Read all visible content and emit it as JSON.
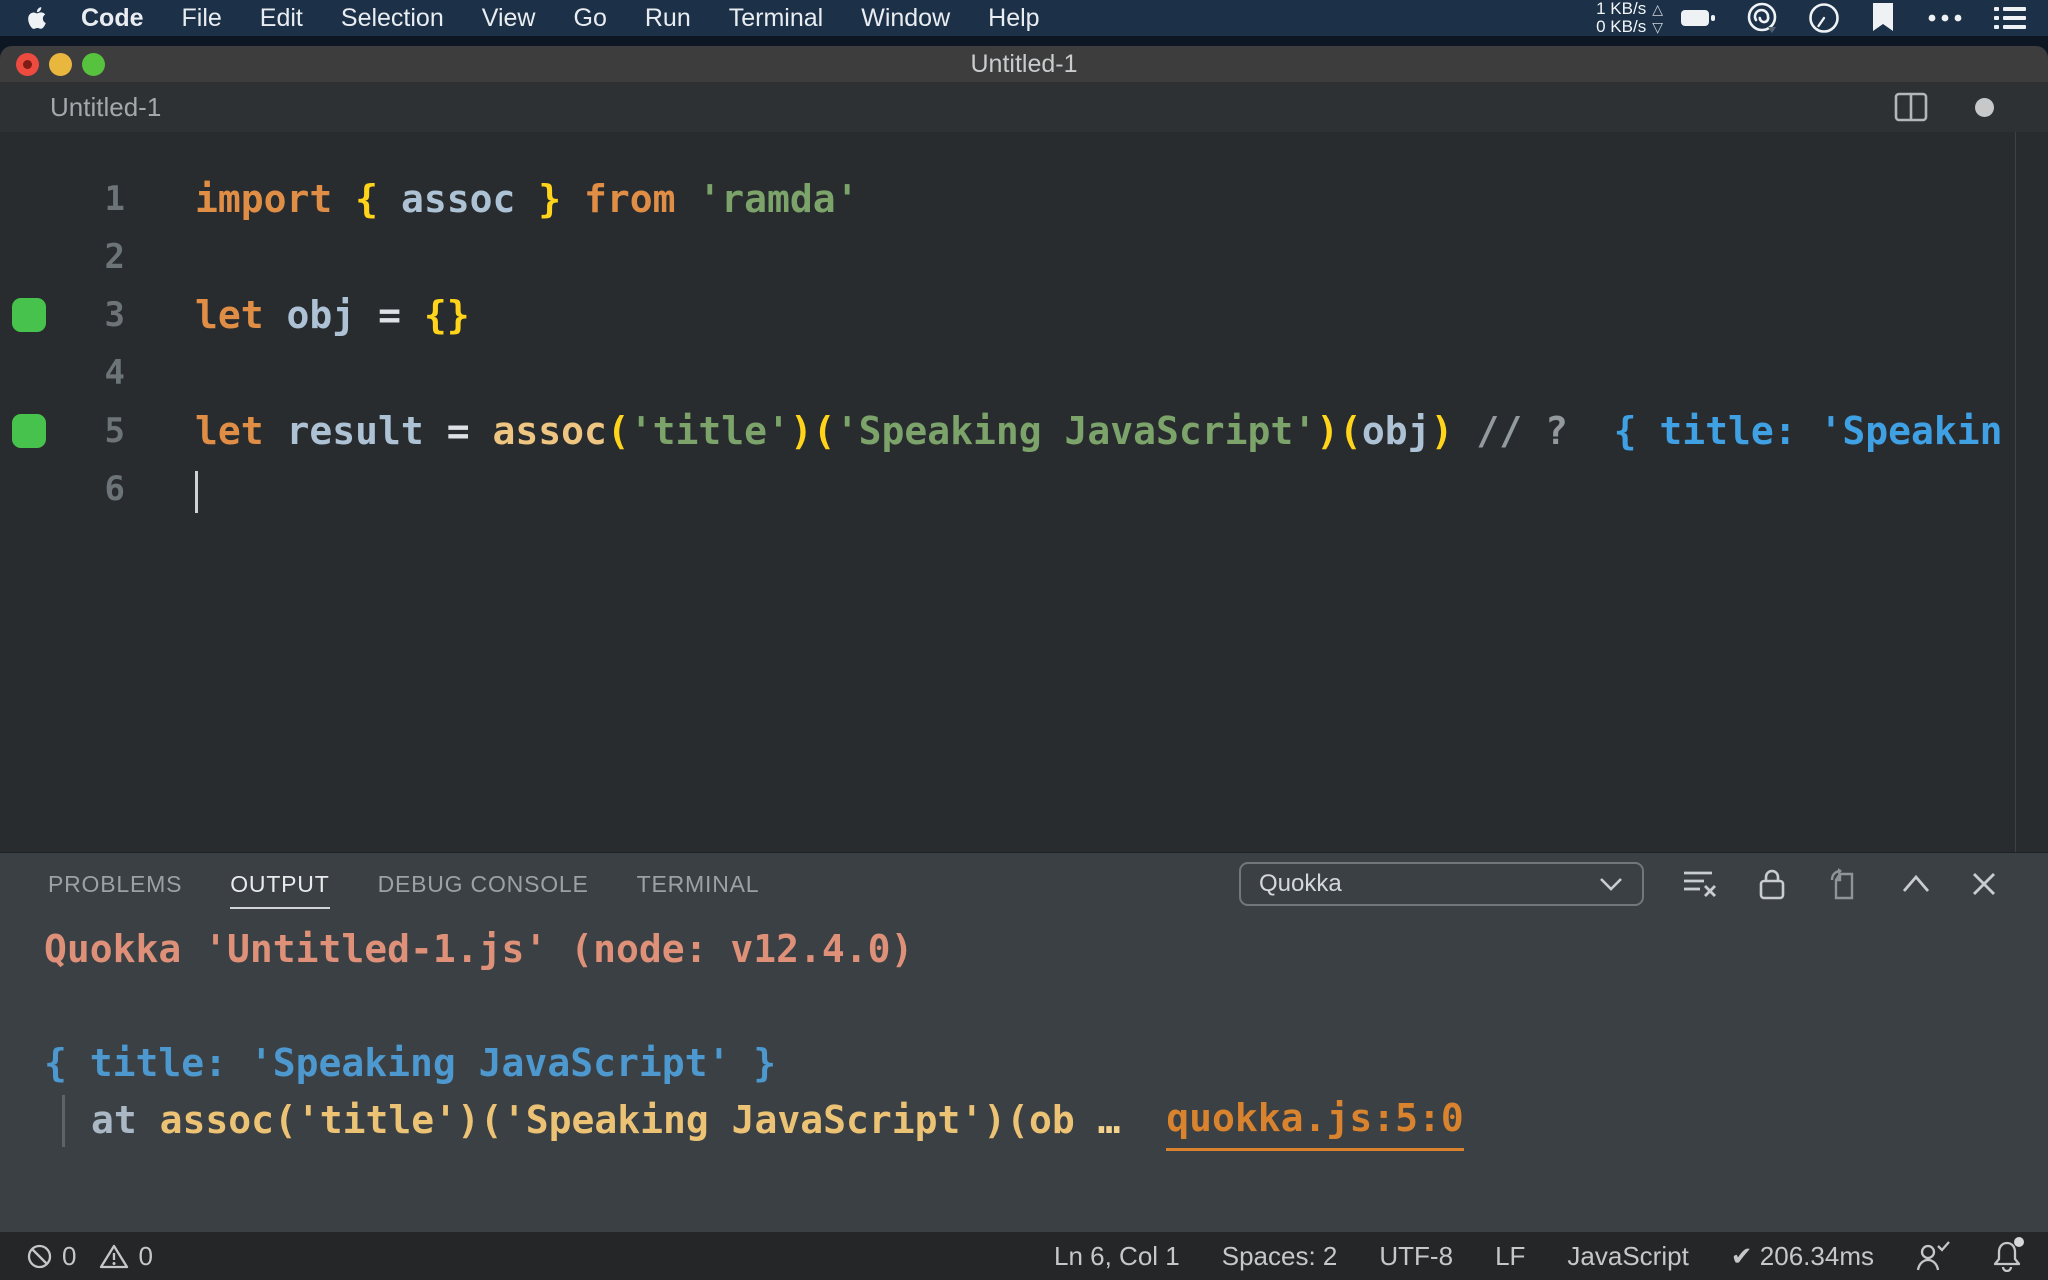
{
  "colors": {
    "menubar_bg": "#1c3048",
    "titlebar_bg": "#3d3d3e",
    "chrome_bg": "#2e3134",
    "editor_bg": "#292c2f",
    "panel_bg": "#3a4044",
    "statusbar_bg": "#252628",
    "keyword": "#e08e45",
    "variable": "#adc2d4",
    "bracket": "#ffd41a",
    "string": "#7ba36a",
    "function": "#eec581",
    "comment": "#939a9e",
    "quokka_inline_value": "#3fa1e3",
    "quokka_marker": "#47c34d",
    "output_info": "#de9078",
    "output_value": "#4d99cf",
    "output_code": "#ecc275",
    "output_link": "#d9832e"
  },
  "menubar": {
    "items": [
      {
        "label": "Code",
        "bold": true
      },
      {
        "label": "File"
      },
      {
        "label": "Edit"
      },
      {
        "label": "Selection"
      },
      {
        "label": "View"
      },
      {
        "label": "Go"
      },
      {
        "label": "Run"
      },
      {
        "label": "Terminal"
      },
      {
        "label": "Window"
      },
      {
        "label": "Help"
      }
    ],
    "net_up": "1 KB/s",
    "net_up_arrow": "△",
    "net_down": "0 KB/s",
    "net_down_arrow": "▽"
  },
  "window": {
    "title": "Untitled-1"
  },
  "editor": {
    "tab_label": "Untitled-1",
    "lines": [
      {
        "num": "1",
        "marker": false,
        "tokens": [
          {
            "c": "kw",
            "t": "import"
          },
          {
            "c": "pl",
            "t": " "
          },
          {
            "c": "br",
            "t": "{"
          },
          {
            "c": "pl",
            "t": " "
          },
          {
            "c": "var",
            "t": "assoc"
          },
          {
            "c": "pl",
            "t": " "
          },
          {
            "c": "br",
            "t": "}"
          },
          {
            "c": "pl",
            "t": " "
          },
          {
            "c": "kw",
            "t": "from"
          },
          {
            "c": "pl",
            "t": " "
          },
          {
            "c": "str",
            "t": "'ramda'"
          }
        ]
      },
      {
        "num": "2",
        "marker": false,
        "tokens": []
      },
      {
        "num": "3",
        "marker": true,
        "tokens": [
          {
            "c": "kw",
            "t": "let"
          },
          {
            "c": "pl",
            "t": " "
          },
          {
            "c": "var",
            "t": "obj"
          },
          {
            "c": "pl",
            "t": " "
          },
          {
            "c": "op",
            "t": "="
          },
          {
            "c": "pl",
            "t": " "
          },
          {
            "c": "br",
            "t": "{}"
          }
        ]
      },
      {
        "num": "4",
        "marker": false,
        "tokens": []
      },
      {
        "num": "5",
        "marker": true,
        "tokens": [
          {
            "c": "kw",
            "t": "let"
          },
          {
            "c": "pl",
            "t": " "
          },
          {
            "c": "var",
            "t": "result"
          },
          {
            "c": "pl",
            "t": " "
          },
          {
            "c": "op",
            "t": "="
          },
          {
            "c": "pl",
            "t": " "
          },
          {
            "c": "fn",
            "t": "assoc"
          },
          {
            "c": "br",
            "t": "("
          },
          {
            "c": "str",
            "t": "'title'"
          },
          {
            "c": "br",
            "t": ")("
          },
          {
            "c": "str",
            "t": "'Speaking JavaScript'"
          },
          {
            "c": "br",
            "t": ")("
          },
          {
            "c": "var",
            "t": "obj"
          },
          {
            "c": "br",
            "t": ")"
          },
          {
            "c": "pl",
            "t": " "
          },
          {
            "c": "cm",
            "t": "// ?"
          },
          {
            "c": "pl",
            "t": "  "
          },
          {
            "c": "qk",
            "t": "{ title: 'Speakin"
          }
        ]
      },
      {
        "num": "6",
        "marker": false,
        "cursor": true,
        "tokens": []
      }
    ]
  },
  "panel": {
    "tabs": [
      {
        "label": "PROBLEMS",
        "active": false
      },
      {
        "label": "OUTPUT",
        "active": true
      },
      {
        "label": "DEBUG CONSOLE",
        "active": false
      },
      {
        "label": "TERMINAL",
        "active": false
      }
    ],
    "channel_select": {
      "value": "Quokka"
    },
    "output": [
      {
        "bar": false,
        "tokens": [
          {
            "c": "salmon",
            "t": "Quokka 'Untitled-1.js' (node: v12.4.0)"
          }
        ]
      },
      {
        "bar": false,
        "tokens": []
      },
      {
        "bar": false,
        "tokens": [
          {
            "c": "blue",
            "t": "{ title: 'Speaking JavaScript' }"
          }
        ]
      },
      {
        "bar": true,
        "tokens": [
          {
            "c": "at",
            "t": "at "
          },
          {
            "c": "gold",
            "t": "assoc('title')('Speaking JavaScript')(ob"
          },
          {
            "c": "dots",
            "t": " … "
          },
          {
            "c": "pl2",
            "t": " "
          },
          {
            "c": "link",
            "t": "quokka.js:5:0"
          }
        ]
      }
    ]
  },
  "statusbar": {
    "error_count": "0",
    "warning_count": "0",
    "items": [
      {
        "label": "Ln 6, Col 1"
      },
      {
        "label": "Spaces: 2"
      },
      {
        "label": "UTF-8"
      },
      {
        "label": "LF"
      },
      {
        "label": "JavaScript"
      },
      {
        "label": "✔ 206.34ms"
      }
    ]
  }
}
